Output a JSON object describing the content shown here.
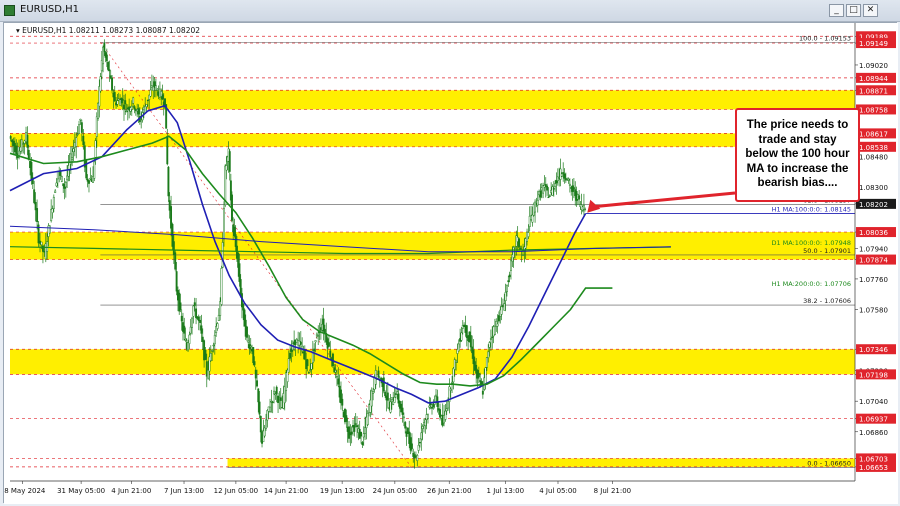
{
  "window": {
    "title": "EURUSD,H1",
    "minimize_label": "_",
    "maximize_label": "□",
    "close_label": "✕",
    "icon": "chart-window-icon"
  },
  "chart_header": {
    "symbol_text": "EURUSD,H1",
    "ohlc_text": "1.08211 1.08273 1.08087 1.08202"
  },
  "annotation": {
    "text": "The price needs to trade and stay below the 100 hour MA to increase the bearish bias...."
  },
  "colors": {
    "zone": "#ffef00",
    "ma100": "#1f1fb4",
    "ma200": "#1d8a1d",
    "candle": "#1a7a1a",
    "price_label_red": "#e0242c",
    "current_price_bg": "#1a1a1a",
    "arrow": "#e0242c"
  },
  "chart_data": {
    "type": "candlestick",
    "symbol": "EURUSD",
    "timeframe": "H1",
    "ylim": [
      1.0657,
      1.0922
    ],
    "xlim": [
      0,
      1010
    ],
    "current_price": 1.08202,
    "x_ticks": [
      {
        "label": "28 May 2024",
        "pos": 15
      },
      {
        "label": "31 May 05:00",
        "pos": 85
      },
      {
        "label": "4 Jun 21:00",
        "pos": 145
      },
      {
        "label": "7 Jun 13:00",
        "pos": 208
      },
      {
        "label": "12 Jun 05:00",
        "pos": 270
      },
      {
        "label": "14 Jun 21:00",
        "pos": 330
      },
      {
        "label": "19 Jun 13:00",
        "pos": 397
      },
      {
        "label": "24 Jun 05:00",
        "pos": 460
      },
      {
        "label": "26 Jun 21:00",
        "pos": 525
      },
      {
        "label": "1 Jul 13:00",
        "pos": 592
      },
      {
        "label": "4 Jul 05:00",
        "pos": 655
      },
      {
        "label": "8 Jul 21:00",
        "pos": 720
      }
    ],
    "y_labels": [
      {
        "value": 1.09189,
        "label": "1.09189",
        "style": "red"
      },
      {
        "value": 1.09149,
        "label": "1.09149",
        "style": "red"
      },
      {
        "value": 1.0902,
        "label": "1.09020",
        "style": "plain"
      },
      {
        "value": 1.08944,
        "label": "1.08944",
        "style": "red"
      },
      {
        "value": 1.08871,
        "label": "1.08871",
        "style": "red"
      },
      {
        "value": 1.08758,
        "label": "1.08758",
        "style": "red"
      },
      {
        "value": 1.08617,
        "label": "1.08617",
        "style": "red"
      },
      {
        "value": 1.08538,
        "label": "1.08538",
        "style": "red"
      },
      {
        "value": 1.0848,
        "label": "1.08480",
        "style": "plain"
      },
      {
        "value": 1.083,
        "label": "1.08300",
        "style": "plain"
      },
      {
        "value": 1.08202,
        "label": "1.08202",
        "style": "current"
      },
      {
        "value": 1.08036,
        "label": "1.08036",
        "style": "red"
      },
      {
        "value": 1.0794,
        "label": "1.07940",
        "style": "plain"
      },
      {
        "value": 1.07874,
        "label": "1.07874",
        "style": "red"
      },
      {
        "value": 1.0776,
        "label": "1.07760",
        "style": "plain"
      },
      {
        "value": 1.0758,
        "label": "1.07580",
        "style": "plain"
      },
      {
        "value": 1.07346,
        "label": "1.07346",
        "style": "red"
      },
      {
        "value": 1.0722,
        "label": "1.07220",
        "style": "plain"
      },
      {
        "value": 1.07198,
        "label": "1.07198",
        "style": "red"
      },
      {
        "value": 1.0704,
        "label": "1.07040",
        "style": "plain"
      },
      {
        "value": 1.06937,
        "label": "1.06937",
        "style": "red"
      },
      {
        "value": 1.0686,
        "label": "1.06860",
        "style": "plain"
      },
      {
        "value": 1.06703,
        "label": "1.06703",
        "style": "red"
      },
      {
        "value": 1.06653,
        "label": "1.06653",
        "style": "red"
      }
    ],
    "zones": [
      {
        "low": 1.08758,
        "high": 1.08871
      },
      {
        "low": 1.08538,
        "high": 1.08617
      },
      {
        "low": 1.07874,
        "high": 1.08036
      },
      {
        "low": 1.07198,
        "high": 1.07346
      },
      {
        "low": 1.06653,
        "high": 1.06703,
        "x_start": 260
      }
    ],
    "red_dashed_levels": [
      1.09189,
      1.09149,
      1.08944,
      1.08871,
      1.08758,
      1.08617,
      1.08538,
      1.08036,
      1.07874,
      1.07346,
      1.07198,
      1.06937,
      1.06703,
      1.06653
    ],
    "fib_levels": [
      {
        "value": 1.09153,
        "label": "100.0 - 1.09153",
        "x_start": 108
      },
      {
        "value": 1.08197,
        "label": "61.8 - 1.08197",
        "x_start": 108
      },
      {
        "value": 1.07901,
        "label": "50.0 - 1.07901",
        "x_start": 108
      },
      {
        "value": 1.07606,
        "label": "38.2 - 1.07606",
        "x_start": 108
      },
      {
        "value": 1.0665,
        "label": "0.0 - 1.06650",
        "x_start": 260
      }
    ],
    "fib_trend": {
      "x1": 108,
      "y1": 1.09153,
      "x2": 480,
      "y2": 1.0665
    },
    "ma_labels": [
      {
        "text": "H1 MA:100:0:0: 1.08145",
        "value": 1.08145
      },
      {
        "text": "D1 MA:100:0:0: 1.07948",
        "value": 1.07948
      },
      {
        "text": "H1 MA:200:0:0: 1.07706",
        "value": 1.07706
      }
    ],
    "series": [
      {
        "name": "H1 MA:100",
        "points": [
          [
            0,
            1.0828
          ],
          [
            40,
            1.0838
          ],
          [
            80,
            1.0841
          ],
          [
            110,
            1.0848
          ],
          [
            140,
            1.0864
          ],
          [
            165,
            1.0875
          ],
          [
            185,
            1.0878
          ],
          [
            200,
            1.0868
          ],
          [
            215,
            1.0845
          ],
          [
            230,
            1.082
          ],
          [
            245,
            1.0798
          ],
          [
            262,
            1.0778
          ],
          [
            280,
            1.0762
          ],
          [
            300,
            1.0749
          ],
          [
            320,
            1.074
          ],
          [
            340,
            1.0736
          ],
          [
            360,
            1.0733
          ],
          [
            380,
            1.0729
          ],
          [
            400,
            1.0725
          ],
          [
            420,
            1.0721
          ],
          [
            440,
            1.0717
          ],
          [
            460,
            1.0712
          ],
          [
            480,
            1.0708
          ],
          [
            500,
            1.0703
          ],
          [
            520,
            1.0704
          ],
          [
            540,
            1.0708
          ],
          [
            560,
            1.0712
          ],
          [
            580,
            1.0717
          ],
          [
            600,
            1.073
          ],
          [
            620,
            1.0748
          ],
          [
            640,
            1.0768
          ],
          [
            660,
            1.0788
          ],
          [
            675,
            1.0803
          ],
          [
            688,
            1.08145
          ]
        ]
      },
      {
        "name": "H1 MA:200",
        "points": [
          [
            0,
            1.085
          ],
          [
            40,
            1.0844
          ],
          [
            80,
            1.0845
          ],
          [
            110,
            1.0848
          ],
          [
            140,
            1.0852
          ],
          [
            170,
            1.0856
          ],
          [
            190,
            1.086
          ],
          [
            210,
            1.0852
          ],
          [
            230,
            1.0838
          ],
          [
            250,
            1.0826
          ],
          [
            270,
            1.0815
          ],
          [
            290,
            1.08
          ],
          [
            310,
            1.0783
          ],
          [
            330,
            1.0765
          ],
          [
            350,
            1.0752
          ],
          [
            370,
            1.0745
          ],
          [
            390,
            1.0741
          ],
          [
            410,
            1.0737
          ],
          [
            430,
            1.0732
          ],
          [
            450,
            1.0726
          ],
          [
            470,
            1.072
          ],
          [
            490,
            1.0715
          ],
          [
            510,
            1.0714
          ],
          [
            530,
            1.0714
          ],
          [
            550,
            1.0713
          ],
          [
            570,
            1.0714
          ],
          [
            590,
            1.0719
          ],
          [
            610,
            1.0728
          ],
          [
            630,
            1.0738
          ],
          [
            650,
            1.0748
          ],
          [
            670,
            1.0758
          ],
          [
            688,
            1.07706
          ],
          [
            720,
            1.07706
          ]
        ]
      },
      {
        "name": "D1 MA:100",
        "points": [
          [
            0,
            1.0795
          ],
          [
            100,
            1.0794
          ],
          [
            200,
            1.0793
          ],
          [
            300,
            1.0792
          ],
          [
            400,
            1.0791
          ],
          [
            500,
            1.0791
          ],
          [
            600,
            1.0793
          ],
          [
            700,
            1.0794
          ],
          [
            790,
            1.07948
          ]
        ]
      },
      {
        "name": "D1 MA:200 band",
        "points": [
          [
            0,
            1.0807
          ],
          [
            100,
            1.0805
          ],
          [
            200,
            1.0802
          ],
          [
            300,
            1.0798
          ],
          [
            400,
            1.0795
          ],
          [
            500,
            1.0792
          ],
          [
            600,
            1.0792
          ],
          [
            700,
            1.0794
          ],
          [
            790,
            1.0795
          ]
        ]
      },
      {
        "name": "Close",
        "points": [
          [
            0,
            1.086
          ],
          [
            10,
            1.085
          ],
          [
            20,
            1.086
          ],
          [
            28,
            1.083
          ],
          [
            35,
            1.08
          ],
          [
            42,
            1.079
          ],
          [
            50,
            1.0815
          ],
          [
            58,
            1.084
          ],
          [
            66,
            1.083
          ],
          [
            75,
            1.085
          ],
          [
            85,
            1.087
          ],
          [
            92,
            1.0835
          ],
          [
            100,
            1.0835
          ],
          [
            106,
            1.088
          ],
          [
            112,
            1.0912
          ],
          [
            118,
            1.09
          ],
          [
            126,
            1.088
          ],
          [
            134,
            1.0882
          ],
          [
            140,
            1.0876
          ],
          [
            148,
            1.088
          ],
          [
            156,
            1.087
          ],
          [
            164,
            1.088
          ],
          [
            172,
            1.089
          ],
          [
            180,
            1.0885
          ],
          [
            186,
            1.088
          ],
          [
            190,
            1.0825
          ],
          [
            195,
            1.0798
          ],
          [
            200,
            1.077
          ],
          [
            206,
            1.075
          ],
          [
            212,
            1.0735
          ],
          [
            220,
            1.076
          ],
          [
            228,
            1.0748
          ],
          [
            236,
            1.072
          ],
          [
            244,
            1.074
          ],
          [
            252,
            1.076
          ],
          [
            258,
            1.084
          ],
          [
            262,
            1.085
          ],
          [
            266,
            1.081
          ],
          [
            272,
            1.079
          ],
          [
            278,
            1.076
          ],
          [
            284,
            1.074
          ],
          [
            290,
            1.0735
          ],
          [
            296,
            1.071
          ],
          [
            302,
            1.068
          ],
          [
            310,
            1.07
          ],
          [
            318,
            1.071
          ],
          [
            326,
            1.07
          ],
          [
            334,
            1.073
          ],
          [
            342,
            1.074
          ],
          [
            350,
            1.0735
          ],
          [
            358,
            1.072
          ],
          [
            366,
            1.074
          ],
          [
            374,
            1.075
          ],
          [
            382,
            1.0735
          ],
          [
            390,
            1.072
          ],
          [
            398,
            1.07
          ],
          [
            406,
            1.0685
          ],
          [
            414,
            1.069
          ],
          [
            422,
            1.068
          ],
          [
            430,
            1.07
          ],
          [
            438,
            1.072
          ],
          [
            446,
            1.0715
          ],
          [
            454,
            1.07
          ],
          [
            462,
            1.071
          ],
          [
            470,
            1.0695
          ],
          [
            478,
            1.068
          ],
          [
            486,
            1.067
          ],
          [
            494,
            1.069
          ],
          [
            502,
            1.07
          ],
          [
            510,
            1.0705
          ],
          [
            518,
            1.069
          ],
          [
            526,
            1.071
          ],
          [
            534,
            1.073
          ],
          [
            542,
            1.075
          ],
          [
            550,
            1.074
          ],
          [
            558,
            1.072
          ],
          [
            566,
            1.071
          ],
          [
            574,
            1.074
          ],
          [
            582,
            1.075
          ],
          [
            590,
            1.076
          ],
          [
            598,
            1.078
          ],
          [
            606,
            1.08
          ],
          [
            614,
            1.079
          ],
          [
            622,
            1.081
          ],
          [
            630,
            1.0822
          ],
          [
            638,
            1.083
          ],
          [
            646,
            1.0825
          ],
          [
            654,
            1.0835
          ],
          [
            662,
            1.084
          ],
          [
            670,
            1.083
          ],
          [
            678,
            1.0825
          ],
          [
            684,
            1.0818
          ],
          [
            688,
            1.08202
          ]
        ]
      }
    ]
  }
}
